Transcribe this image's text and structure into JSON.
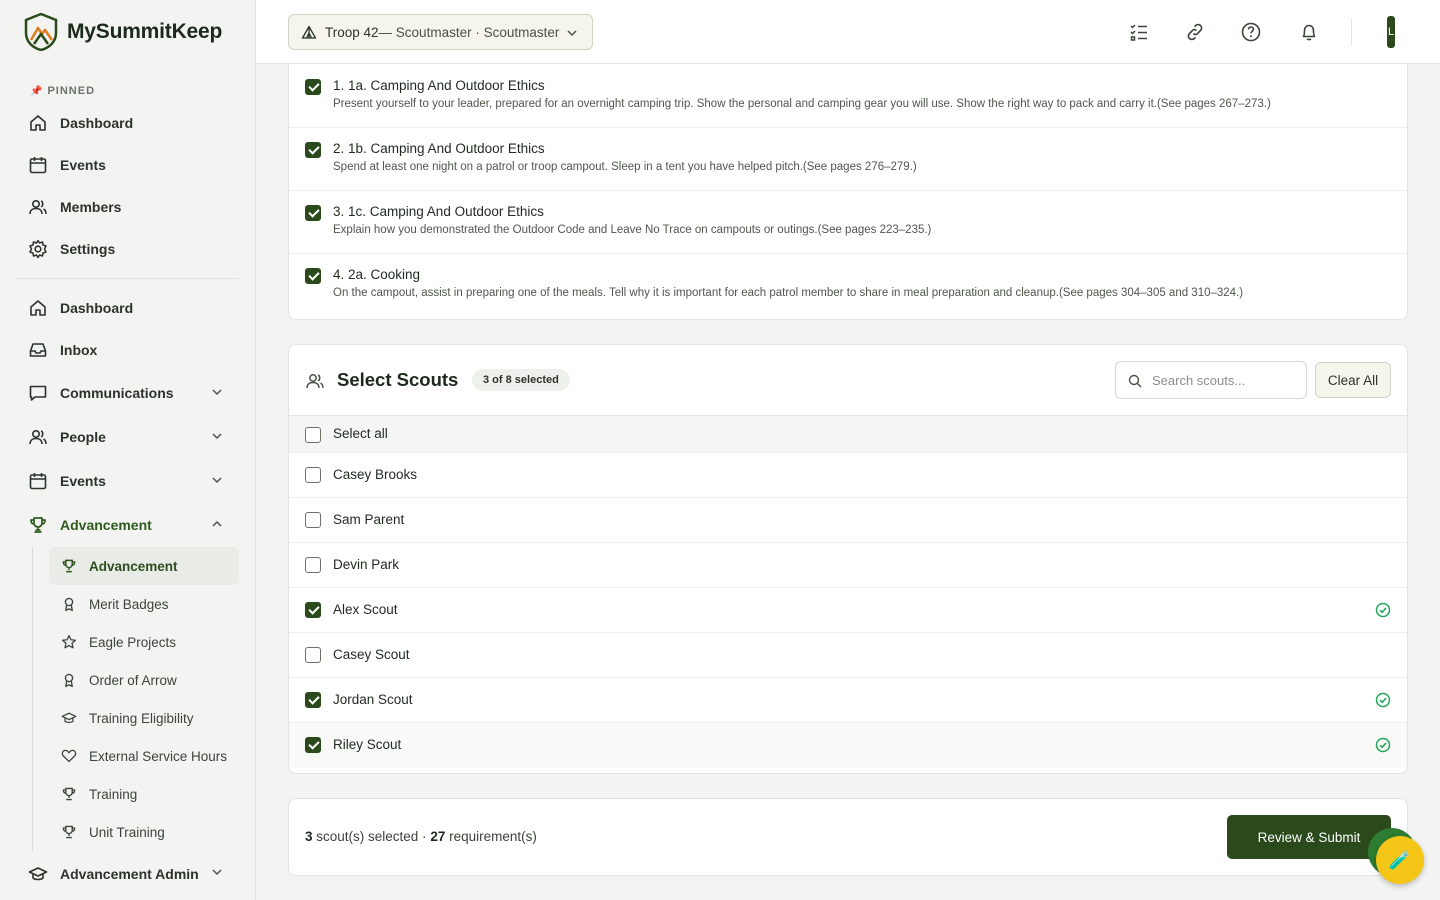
{
  "brand": {
    "name": "MySummitKeep"
  },
  "sidebar": {
    "pinned_label": "PINNED",
    "pinned": [
      {
        "label": "Dashboard",
        "icon": "home-icon"
      },
      {
        "label": "Events",
        "icon": "calendar-icon"
      },
      {
        "label": "Members",
        "icon": "users-icon"
      },
      {
        "label": "Settings",
        "icon": "gear-icon"
      }
    ],
    "main": [
      {
        "label": "Dashboard",
        "icon": "home-icon"
      },
      {
        "label": "Inbox",
        "icon": "inbox-icon"
      },
      {
        "label": "Communications",
        "icon": "chat-icon",
        "expandable": true
      },
      {
        "label": "People",
        "icon": "users-icon",
        "expandable": true
      },
      {
        "label": "Events",
        "icon": "calendar-icon",
        "expandable": true
      },
      {
        "label": "Advancement",
        "icon": "trophy-icon",
        "expanded": true
      }
    ],
    "advancement_sub": [
      {
        "label": "Advancement",
        "icon": "trophy-icon",
        "active": true
      },
      {
        "label": "Merit Badges",
        "icon": "badge-icon"
      },
      {
        "label": "Eagle Projects",
        "icon": "star-icon"
      },
      {
        "label": "Order of Arrow",
        "icon": "badge-icon"
      },
      {
        "label": "Training Eligibility",
        "icon": "graduation-cap-icon"
      },
      {
        "label": "External Service Hours",
        "icon": "heart-icon"
      },
      {
        "label": "Training",
        "icon": "trophy-icon"
      },
      {
        "label": "Unit Training",
        "icon": "trophy-icon"
      }
    ],
    "advancement_admin": {
      "label": "Advancement Admin",
      "icon": "graduation-cap-icon"
    }
  },
  "topbar": {
    "troop": "Troop 42",
    "role": " — Scoutmaster · Scoutmaster",
    "avatar_initial": "L"
  },
  "requirements": [
    {
      "title": "1. 1a. Camping And Outdoor Ethics",
      "desc": "Present yourself to your leader, prepared for an overnight camping trip. Show the personal and camping gear you will use. Show the right way to pack and carry it.(See pages 267–273.)",
      "checked": true
    },
    {
      "title": "2. 1b. Camping And Outdoor Ethics",
      "desc": "Spend at least one night on a patrol or troop campout. Sleep in a tent you have helped pitch.(See pages 276–279.)",
      "checked": true
    },
    {
      "title": "3. 1c. Camping And Outdoor Ethics",
      "desc": "Explain how you demonstrated the Outdoor Code and Leave No Trace on campouts or outings.(See pages 223–235.)",
      "checked": true
    },
    {
      "title": "4. 2a. Cooking",
      "desc": "On the campout, assist in preparing one of the meals. Tell why it is important for each patrol member to share in meal preparation and cleanup.(See pages 304–305 and 310–324.)",
      "checked": true
    }
  ],
  "scouts_panel": {
    "title": "Select Scouts",
    "badge": "3 of 8 selected",
    "search_placeholder": "Search scouts...",
    "clear_label": "Clear All",
    "select_all_label": "Select all",
    "scouts": [
      {
        "name": "Casey Brooks",
        "checked": false
      },
      {
        "name": "Sam Parent",
        "checked": false
      },
      {
        "name": "Devin Park",
        "checked": false
      },
      {
        "name": "Alex Scout",
        "checked": true
      },
      {
        "name": "Casey Scout",
        "checked": false
      },
      {
        "name": "Jordan Scout",
        "checked": true
      },
      {
        "name": "Riley Scout",
        "checked": true
      }
    ]
  },
  "footer": {
    "scout_count": "3",
    "scout_text": " scout(s) selected · ",
    "req_count": "27",
    "req_text": " requirement(s)",
    "submit_label": "Review & Submit"
  },
  "colors": {
    "brand_green": "#2b4a1c",
    "success": "#22a55a",
    "fab": "#f5c518"
  }
}
